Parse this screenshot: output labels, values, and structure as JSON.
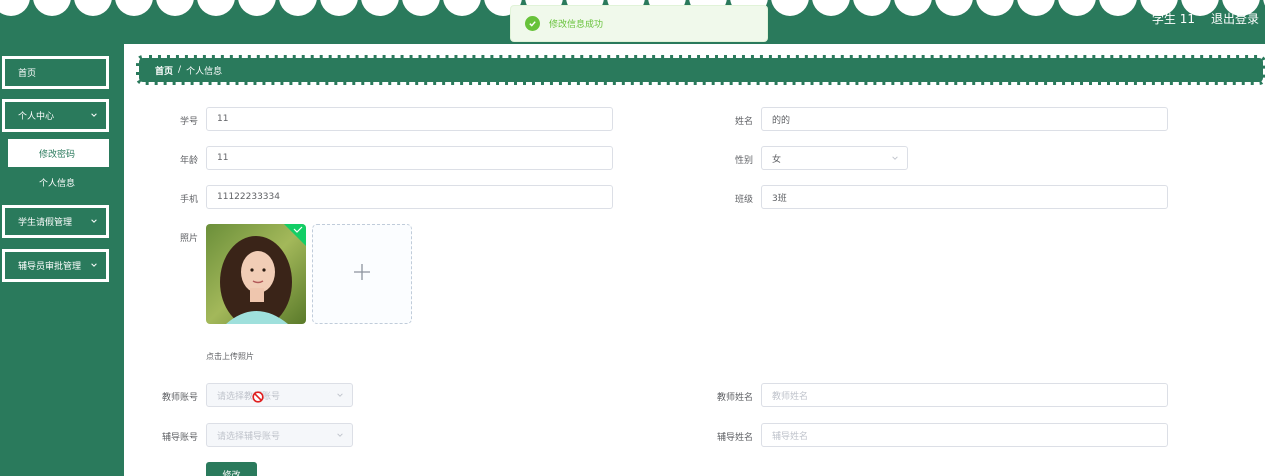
{
  "header": {
    "username": "学生 11",
    "logout_label": "退出登录"
  },
  "toast": {
    "message": "修改信息成功",
    "icon": "check-circle-icon",
    "color": "#67c23a"
  },
  "sidebar": {
    "items": [
      {
        "label": "首页"
      },
      {
        "label": "个人中心",
        "expanded": true,
        "children": [
          {
            "label": "修改密码",
            "active": true
          },
          {
            "label": "个人信息"
          }
        ]
      },
      {
        "label": "学生请假管理"
      },
      {
        "label": "辅导员审批管理"
      }
    ]
  },
  "breadcrumb": {
    "home": "首页",
    "separator": "/",
    "current": "个人信息"
  },
  "form": {
    "student_no": {
      "label": "学号",
      "value": "11"
    },
    "name": {
      "label": "姓名",
      "value": "的的"
    },
    "age": {
      "label": "年龄",
      "value": "11"
    },
    "gender": {
      "label": "性别",
      "value": "女"
    },
    "phone": {
      "label": "手机",
      "value": "11122233334"
    },
    "class": {
      "label": "班级",
      "value": "3班"
    },
    "photo": {
      "label": "照片",
      "hint": "点击上传照片"
    },
    "teacher_account": {
      "label": "教师账号",
      "placeholder": "请选择教师账号"
    },
    "teacher_name": {
      "label": "教师姓名",
      "placeholder": "教师姓名"
    },
    "counselor_account": {
      "label": "辅导账号",
      "placeholder": "请选择辅导账号"
    },
    "counselor_name": {
      "label": "辅导姓名",
      "placeholder": "辅导姓名"
    },
    "submit_label": "修改"
  },
  "colors": {
    "primary": "#2a7a5c",
    "success": "#67c23a"
  }
}
